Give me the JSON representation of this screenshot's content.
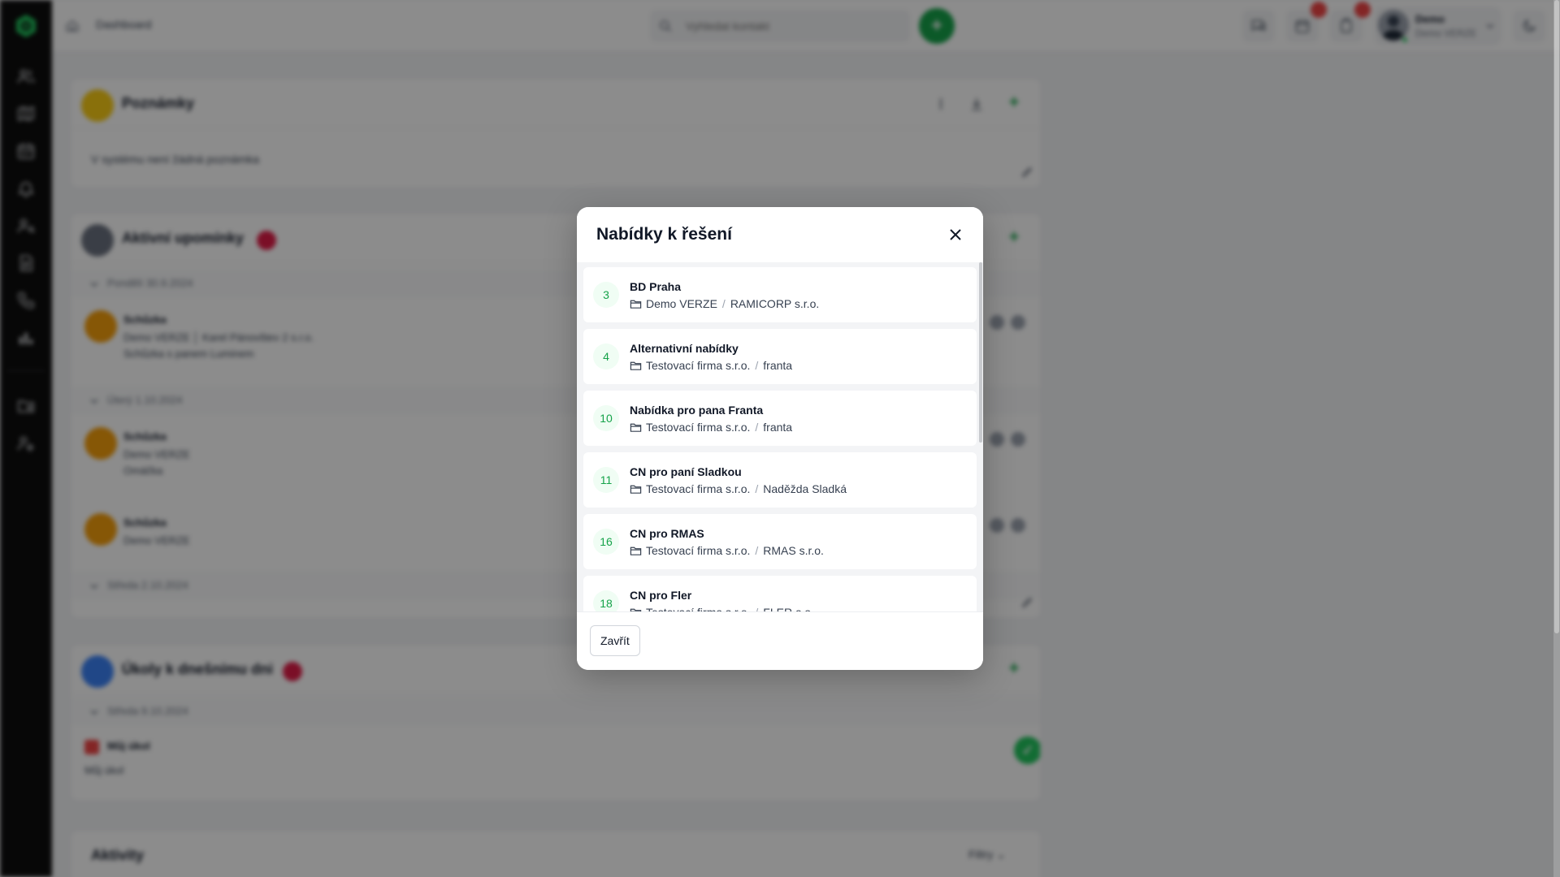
{
  "topbar": {
    "breadcrumb": "Dashboard",
    "search_placeholder": "Vyhledat kontakt",
    "quick_add_label": "+",
    "user_name": "Demo",
    "user_company": "Demo VERZE"
  },
  "cards": {
    "notes": {
      "title": "Poznámky",
      "empty": "V systému není žádná poznámka",
      "add_label": "+"
    },
    "reminders": {
      "title": "Aktivní upomínky",
      "add_label": "+",
      "groups": [
        {
          "label": "Pondělí 30.9.2024",
          "items": [
            {
              "title": "Schůzka",
              "line1": "Demo VERZE  │  Karel Pánovštev 2 s.r.o.",
              "line2": "Schůzka s panem Luminem"
            }
          ]
        },
        {
          "label": "Úterý 1.10.2024",
          "items": [
            {
              "title": "Schůzka",
              "line1": "Demo VERZE",
              "line2": "Omáčka"
            },
            {
              "title": "Schůzka",
              "line1": "Demo VERZE",
              "line2": ""
            }
          ]
        },
        {
          "label": "Středa 2.10.2024",
          "items": []
        }
      ]
    },
    "tasks": {
      "title": "Úkoly k dnešnímu dni",
      "add_label": "+",
      "group_label": "Středa 9.10.2024",
      "task_title": "Můj úkol",
      "task_desc": "Můj úkol",
      "done_label": "✓"
    },
    "activities": {
      "title": "Aktivity",
      "filters_label": "Filtry ⌄"
    }
  },
  "modal": {
    "title": "Nabídky k řešení",
    "close_button": "Zavřít",
    "offers": [
      {
        "number": "3",
        "name": "BD Praha",
        "company": "Demo VERZE",
        "contact": "RAMICORP s.r.o."
      },
      {
        "number": "4",
        "name": "Alternativní nabídky",
        "company": "Testovací firma s.r.o.",
        "contact": "franta"
      },
      {
        "number": "10",
        "name": "Nabídka pro pana Franta",
        "company": "Testovací firma s.r.o.",
        "contact": "franta"
      },
      {
        "number": "11",
        "name": "CN pro paní Sladkou",
        "company": "Testovací firma s.r.o.",
        "contact": "Naděžda Sladká"
      },
      {
        "number": "16",
        "name": "CN pro RMAS",
        "company": "Testovací firma s.r.o.",
        "contact": "RMAS s.r.o."
      },
      {
        "number": "18",
        "name": "CN pro Fler",
        "company": "Testovací firma s.r.o.",
        "contact": "FLER a.s."
      }
    ]
  },
  "colors": {
    "accent_green": "#16a34a",
    "badge_red": "#ef4444",
    "notes_icon": "#facc15",
    "reminder_dot": "#f59e0b",
    "tasks_icon": "#3b82f6"
  },
  "icons": {
    "rail": [
      "contacts-icon",
      "map-icon",
      "calendar-icon",
      "bell-icon",
      "user-search-icon",
      "document-icon",
      "phone-icon",
      "bar-chart-icon",
      "folder-icon",
      "user-settings-icon"
    ]
  }
}
